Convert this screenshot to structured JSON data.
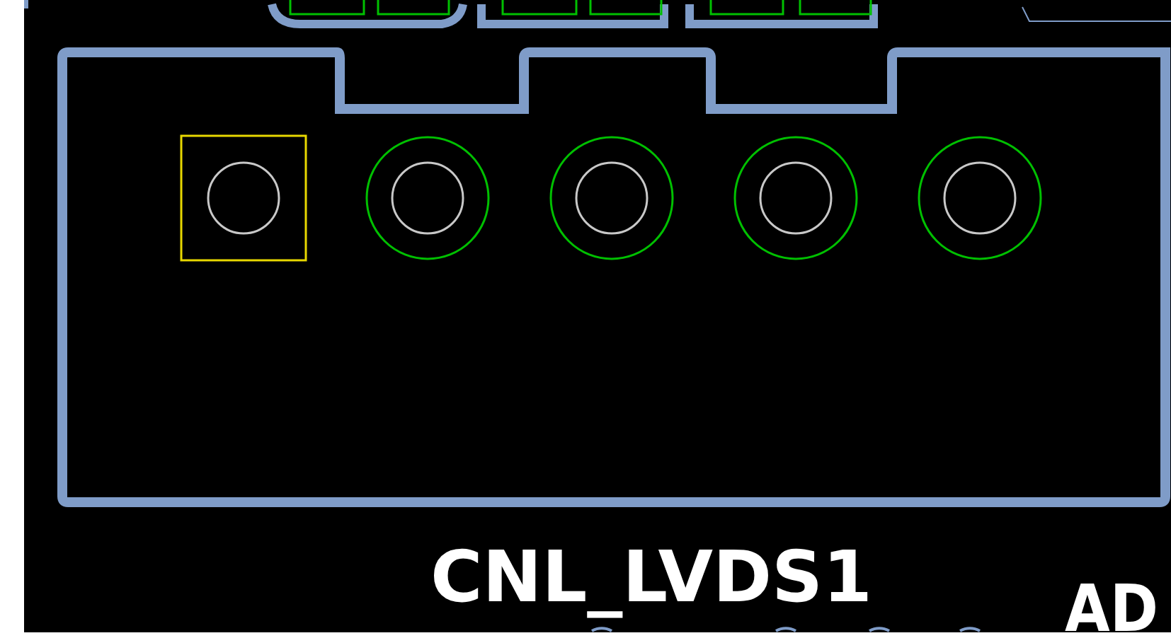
{
  "board": {
    "pads": [
      {
        "kind": "square",
        "selected": true
      },
      {
        "kind": "round",
        "selected": false
      },
      {
        "kind": "round",
        "selected": false
      },
      {
        "kind": "round",
        "selected": false
      },
      {
        "kind": "round",
        "selected": false
      }
    ],
    "labels": [
      {
        "text": "CNL_LVDS1",
        "kind": "designator"
      },
      {
        "text": "AD",
        "kind": "designator_cut"
      }
    ]
  }
}
